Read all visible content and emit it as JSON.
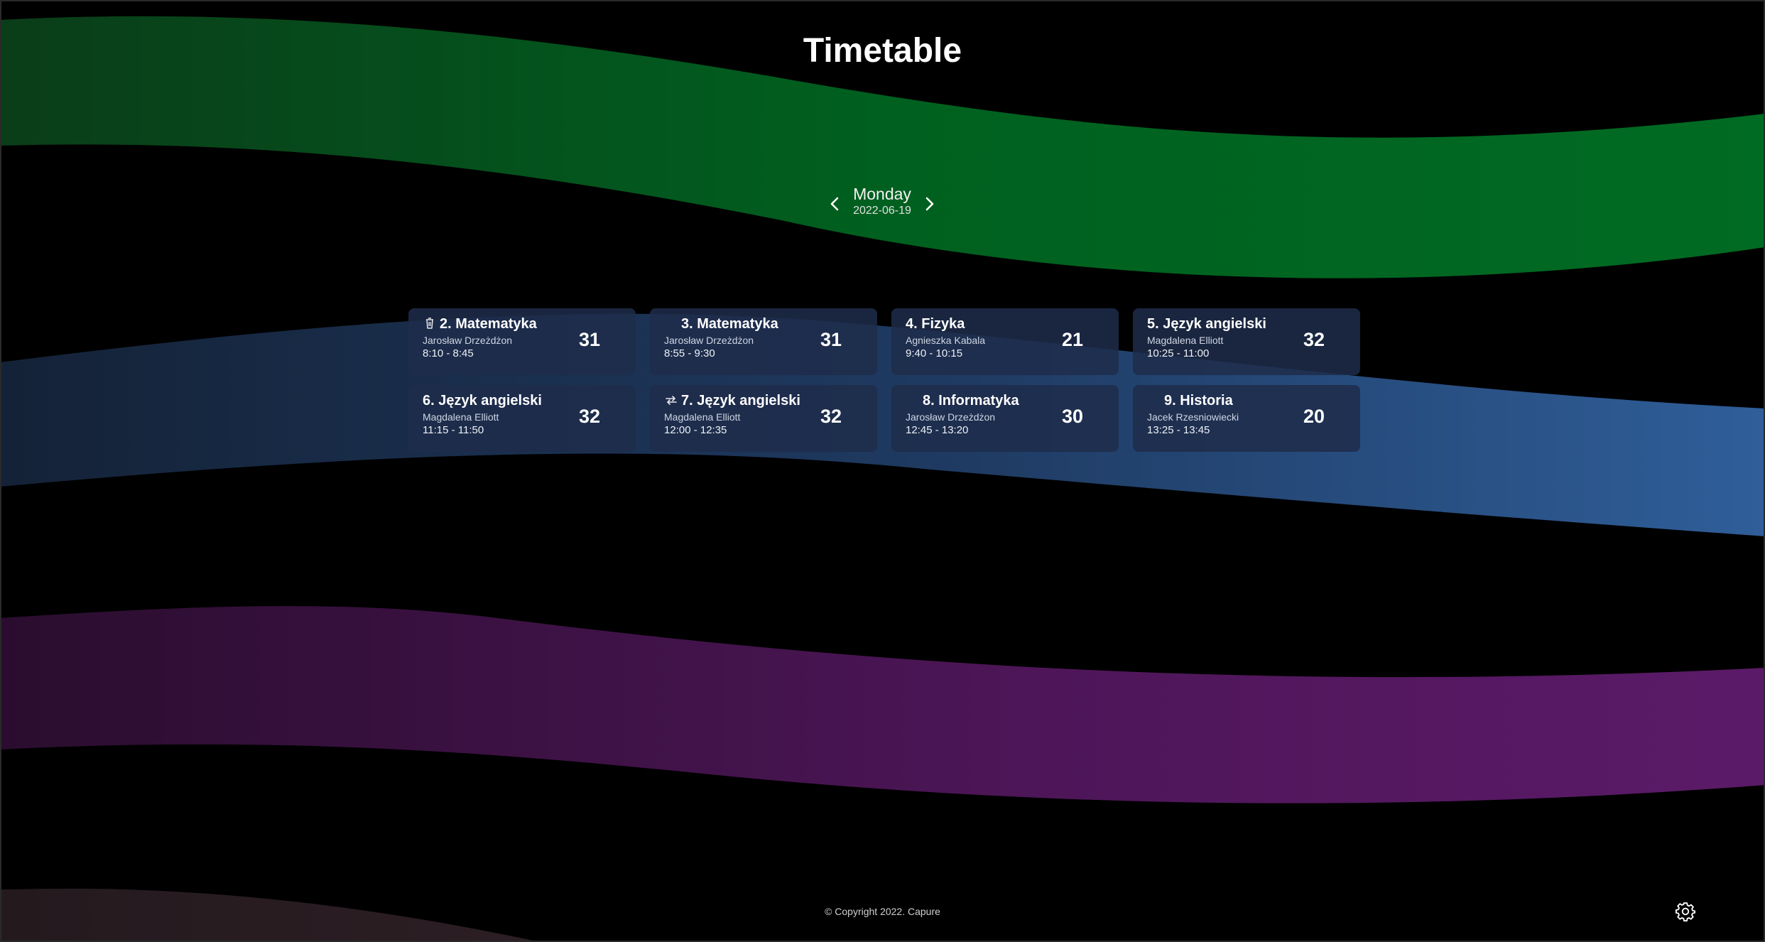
{
  "page": {
    "title": "Timetable",
    "footer": "© Copyright 2022. Capure"
  },
  "navigation": {
    "prev_icon": "chevron-left-icon",
    "next_icon": "chevron-right-icon",
    "day": "Monday",
    "date": "2022-06-19"
  },
  "settings": {
    "icon": "gear-icon"
  },
  "background": {
    "wave_colors": [
      "#006b23",
      "#2e5c97",
      "#5a1866",
      "#2a1d22"
    ]
  },
  "lessons": [
    {
      "title": "2. Matematyka",
      "teacher": "Jarosław Drzeżdżon",
      "time": "8:10 - 8:45",
      "room": "31",
      "badge": "trash-icon"
    },
    {
      "title": "3. Matematyka",
      "teacher": "Jarosław Drzeżdżon",
      "time": "8:55 - 9:30",
      "room": "31",
      "badge": "none"
    },
    {
      "title": "4. Fizyka",
      "teacher": "Agnieszka Kabala",
      "time": "9:40 - 10:15",
      "room": "21",
      "badge": "none"
    },
    {
      "title": "5. Język angielski",
      "teacher": "Magdalena Elliott",
      "time": "10:25 - 11:00",
      "room": "32",
      "badge": "none"
    },
    {
      "title": "6. Język angielski",
      "teacher": "Magdalena Elliott",
      "time": "11:15 - 11:50",
      "room": "32",
      "badge": "none"
    },
    {
      "title": "7. Język angielski",
      "teacher": "Magdalena Elliott",
      "time": "12:00 - 12:35",
      "room": "32",
      "badge": "swap-icon"
    },
    {
      "title": "8. Informatyka",
      "teacher": "Jarosław Drzeżdżon",
      "time": "12:45 - 13:20",
      "room": "30",
      "badge": "none"
    },
    {
      "title": "9. Historia",
      "teacher": "Jacek Rzesniowiecki",
      "time": "13:25 - 13:45",
      "room": "20",
      "badge": "none"
    }
  ]
}
